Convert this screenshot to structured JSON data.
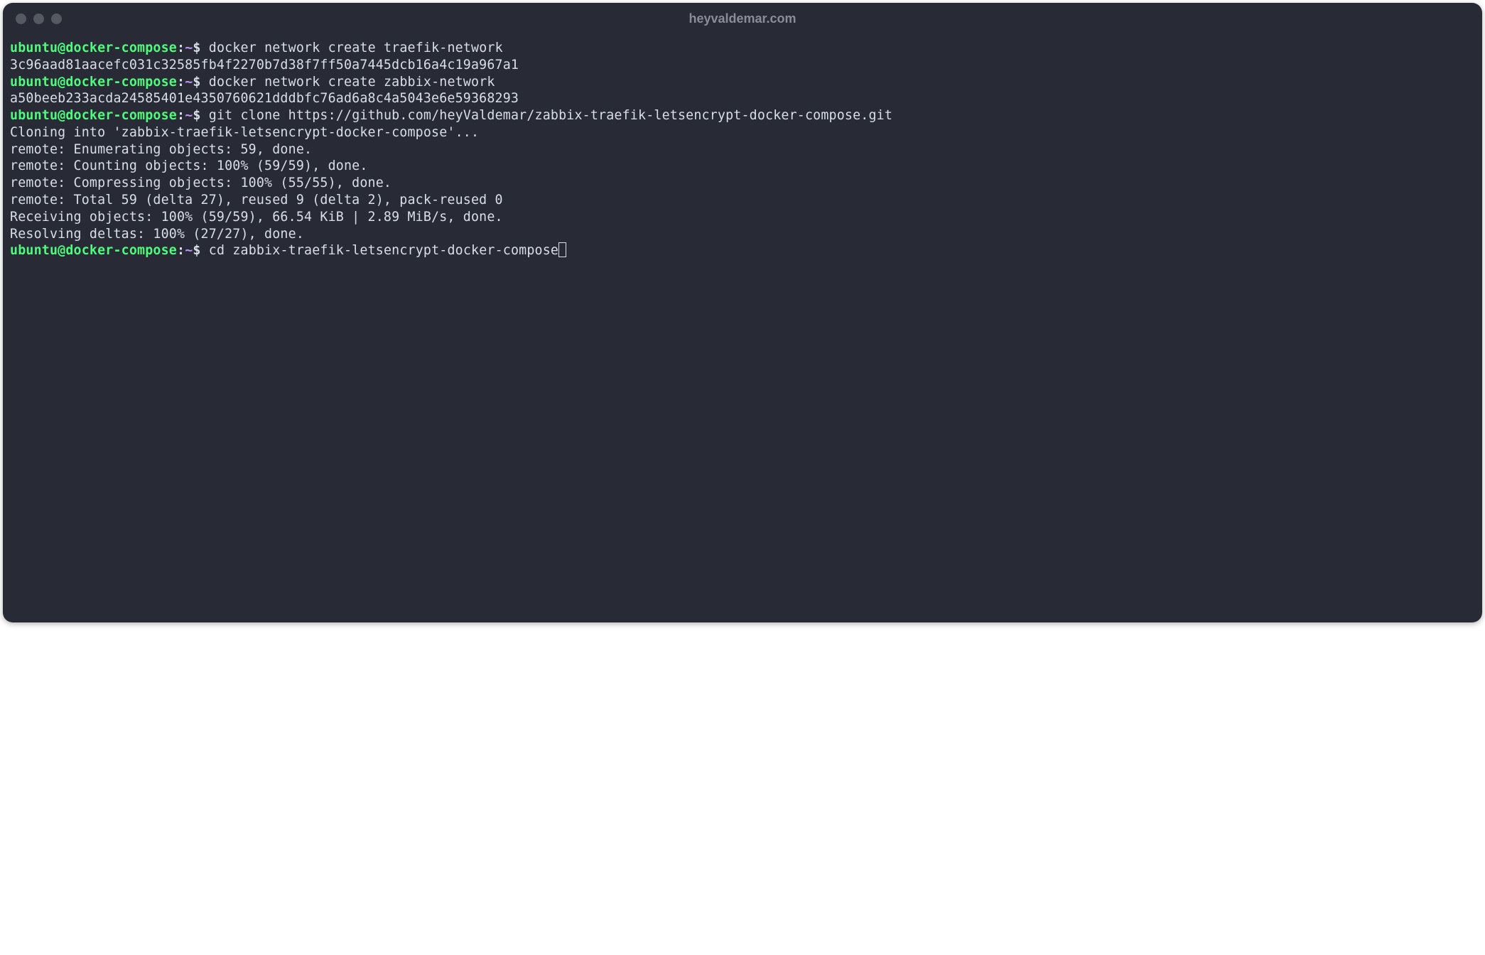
{
  "window": {
    "title": "heyvaldemar.com"
  },
  "prompt": {
    "user_host": "ubuntu@docker-compose",
    "colon": ":",
    "path": "~",
    "symbol": "$"
  },
  "lines": [
    {
      "type": "cmd",
      "text": "docker network create traefik-network"
    },
    {
      "type": "out",
      "text": "3c96aad81aacefc031c32585fb4f2270b7d38f7ff50a7445dcb16a4c19a967a1"
    },
    {
      "type": "cmd",
      "text": "docker network create zabbix-network"
    },
    {
      "type": "out",
      "text": "a50beeb233acda24585401e4350760621dddbfc76ad6a8c4a5043e6e59368293"
    },
    {
      "type": "cmd",
      "text": "git clone https://github.com/heyValdemar/zabbix-traefik-letsencrypt-docker-compose.git"
    },
    {
      "type": "out",
      "text": "Cloning into 'zabbix-traefik-letsencrypt-docker-compose'..."
    },
    {
      "type": "out",
      "text": "remote: Enumerating objects: 59, done."
    },
    {
      "type": "out",
      "text": "remote: Counting objects: 100% (59/59), done."
    },
    {
      "type": "out",
      "text": "remote: Compressing objects: 100% (55/55), done."
    },
    {
      "type": "out",
      "text": "remote: Total 59 (delta 27), reused 9 (delta 2), pack-reused 0"
    },
    {
      "type": "out",
      "text": "Receiving objects: 100% (59/59), 66.54 KiB | 2.89 MiB/s, done."
    },
    {
      "type": "out",
      "text": "Resolving deltas: 100% (27/27), done."
    },
    {
      "type": "cmd_cursor",
      "text": "cd zabbix-traefik-letsencrypt-docker-compose"
    }
  ]
}
